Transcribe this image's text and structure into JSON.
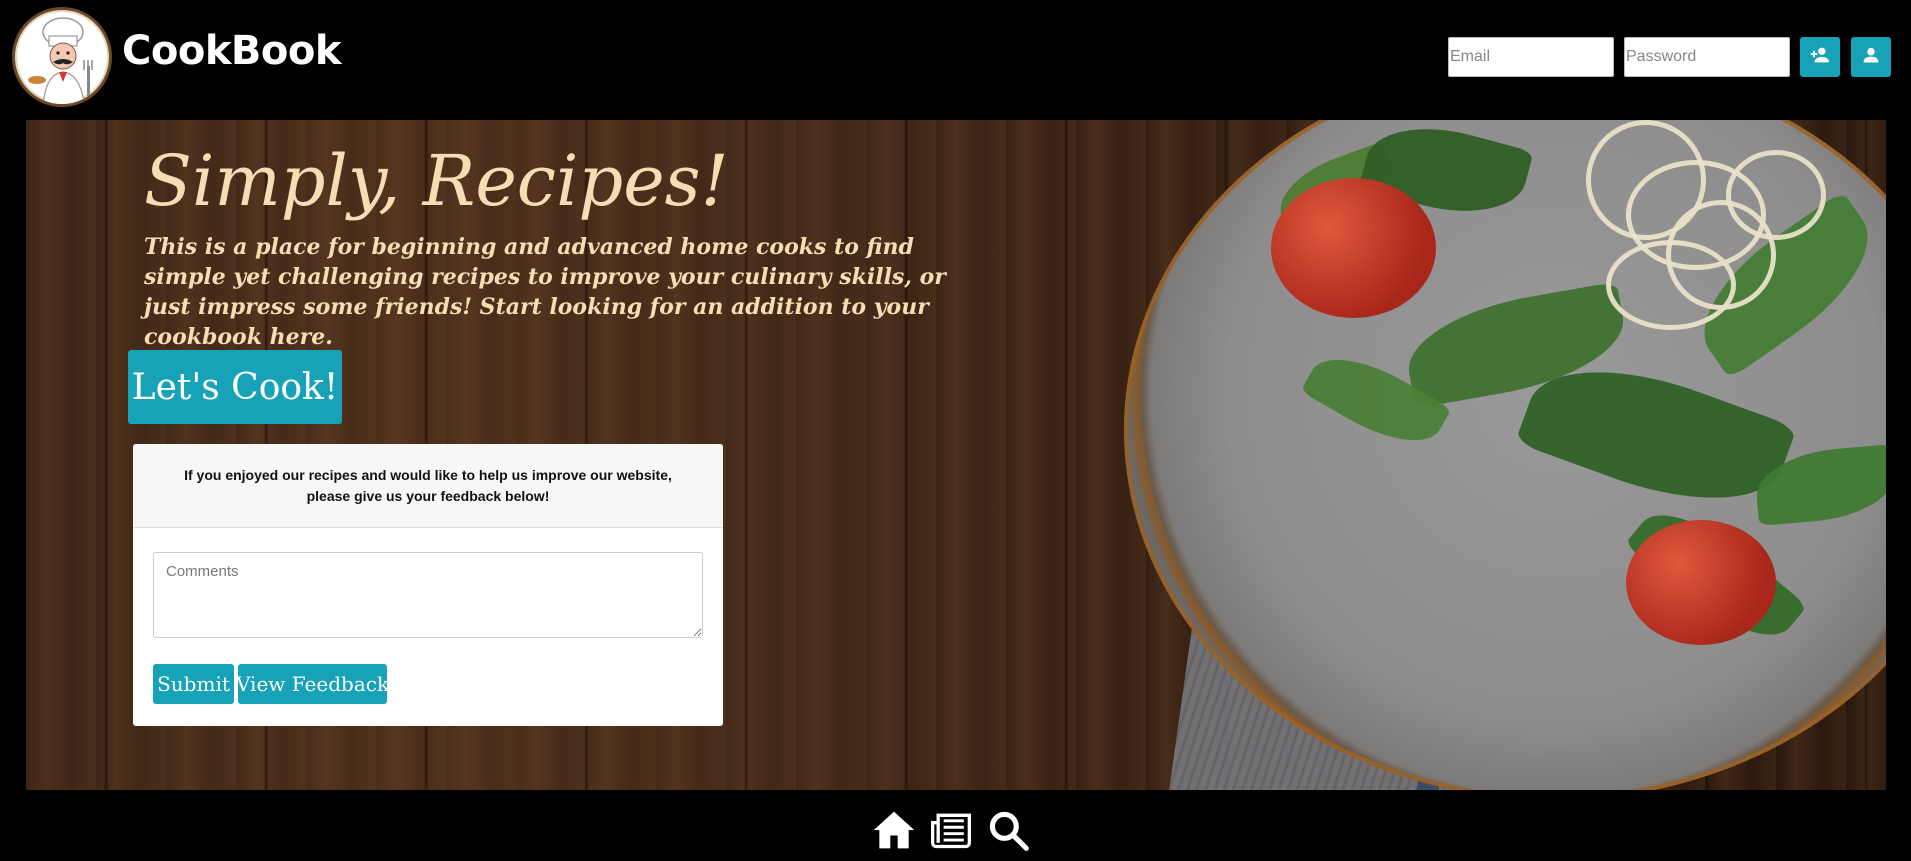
{
  "brand": {
    "name": "CookBook",
    "logo_icon": "chef-logo-icon"
  },
  "login": {
    "email_placeholder": "Email",
    "password_placeholder": "Password",
    "signup_icon": "user-plus-icon",
    "login_icon": "user-icon",
    "accent": "#17a2b8"
  },
  "hero": {
    "title": "Simply, Recipes!",
    "text": "This is a place for beginning and advanced home cooks to find simple yet challenging recipes to improve your culinary skills, or just impress some friends! Start looking for an addition to your cookbook here.",
    "cta_label": "Let's Cook!",
    "text_color": "#f5deb3"
  },
  "feedback": {
    "prompt": "If you enjoyed our recipes and would like to help us improve our website, please give us your feedback below!",
    "comments_placeholder": "Comments",
    "submit_label": "Submit",
    "view_label": "View Feedback"
  },
  "footer_nav": [
    {
      "icon": "home-icon"
    },
    {
      "icon": "newspaper-icon"
    },
    {
      "icon": "search-icon"
    }
  ]
}
